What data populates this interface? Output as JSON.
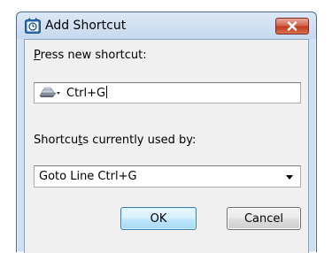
{
  "window": {
    "title": "Add Shortcut",
    "close_icon": "close-x-icon",
    "app_icon": "app-icon"
  },
  "shortcut": {
    "label_mnemonic": "P",
    "label_rest": "ress new shortcut:",
    "value": "Ctrl+G",
    "icon": "keyboard-key-dropdown-icon"
  },
  "used_by": {
    "label_pre": "Shortcu",
    "label_mnemonic": "t",
    "label_post": "s currently used by:",
    "selected": "Goto Line Ctrl+G"
  },
  "buttons": {
    "ok_label": "OK",
    "cancel_label": "Cancel"
  },
  "colors": {
    "titlebar": "#c6d9ee",
    "client_background": "#f0f0f0",
    "close_button": "#c0391f",
    "default_button_border": "#3c7fb1"
  }
}
